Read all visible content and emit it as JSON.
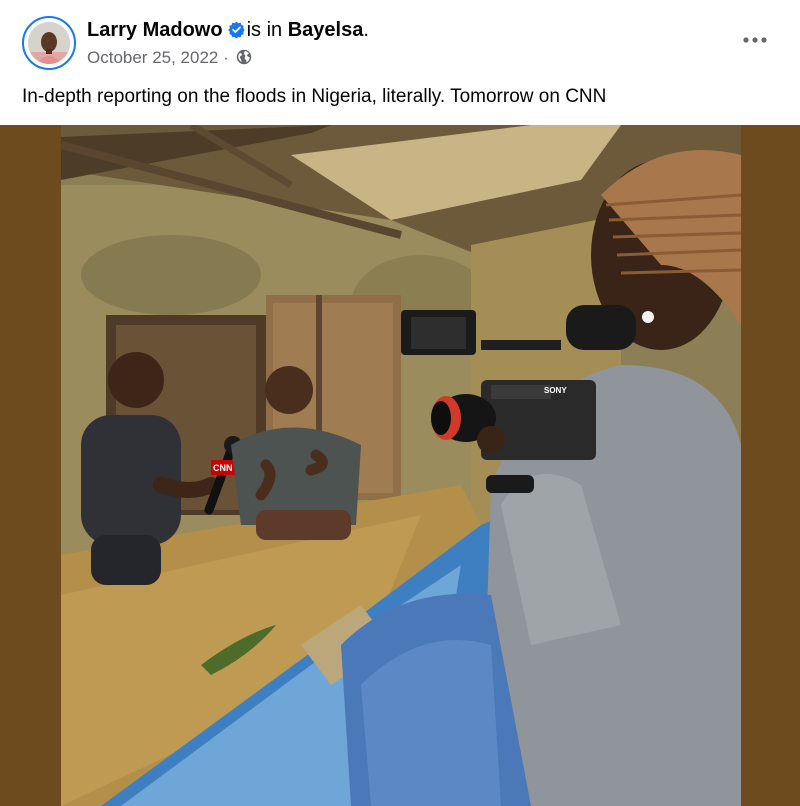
{
  "post": {
    "author": {
      "name": "Larry Madowo",
      "verified": true,
      "status_text": "is in",
      "location": "Bayelsa",
      "location_suffix": "."
    },
    "date": "October 25, 2022",
    "date_separator": "·",
    "privacy_icon": "globe-icon",
    "more_icon": "more-options-icon",
    "caption": "In-depth reporting on the floods in Nigeria, literally. Tomorrow on CNN",
    "photo": {
      "mic_flag_text": "CNN",
      "camera_brand": "SONY"
    }
  },
  "colors": {
    "verified_badge": "#1877f2",
    "avatar_ring": "#1877f2",
    "text_primary": "#050505",
    "text_secondary": "#65676b",
    "photo_background": "#6e4a1f"
  }
}
